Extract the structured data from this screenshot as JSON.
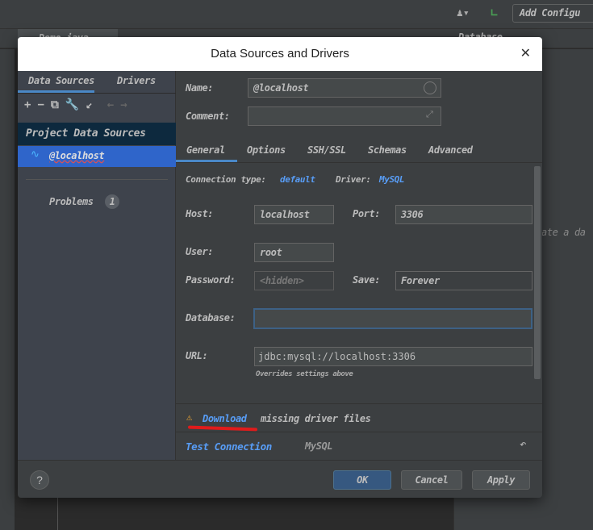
{
  "ide": {
    "add_config_label": "Add Configu",
    "editor_tab": "Demo.java",
    "right_panel_title": "Database",
    "right_panel_hint": "ate a da"
  },
  "dialog": {
    "title": "Data Sources and Drivers",
    "left": {
      "tabs": [
        {
          "label": "Data Sources",
          "active": true
        },
        {
          "label": "Drivers",
          "active": false
        }
      ],
      "toolbar_icons": [
        "plus-icon",
        "minus-icon",
        "copy-icon",
        "wrench-icon",
        "import-icon",
        "back-arrow-icon",
        "forward-arrow-icon"
      ],
      "section_header": "Project Data Sources",
      "items": [
        {
          "label": "@localhost",
          "icon": "mysql-dolphin-icon",
          "selected": true
        }
      ],
      "problems_label": "Problems",
      "problems_count": "1"
    },
    "name_label": "Name:",
    "name_value": "@localhost",
    "comment_label": "Comment:",
    "comment_value": "",
    "tabs": [
      {
        "label": "General",
        "active": true
      },
      {
        "label": "Options"
      },
      {
        "label": "SSH/SSL"
      },
      {
        "label": "Schemas"
      },
      {
        "label": "Advanced"
      }
    ],
    "general": {
      "connection_type_label": "Connection type:",
      "connection_type_value": "default",
      "driver_label": "Driver:",
      "driver_value": "MySQL",
      "host_label": "Host:",
      "host_value": "localhost",
      "port_label": "Port:",
      "port_value": "3306",
      "user_label": "User:",
      "user_value": "root",
      "password_label": "Password:",
      "password_placeholder": "<hidden>",
      "save_label": "Save:",
      "save_value": "Forever",
      "database_label": "Database:",
      "database_value": "",
      "url_label": "URL:",
      "url_value": "jdbc:mysql://localhost:3306",
      "url_hint": "Overrides settings above"
    },
    "warning": {
      "link": "Download",
      "text": "missing driver files"
    },
    "test_connection_label": "Test Connection",
    "driver_name": "MySQL",
    "buttons": {
      "ok": "OK",
      "cancel": "Cancel",
      "apply": "Apply",
      "help": "?"
    }
  }
}
